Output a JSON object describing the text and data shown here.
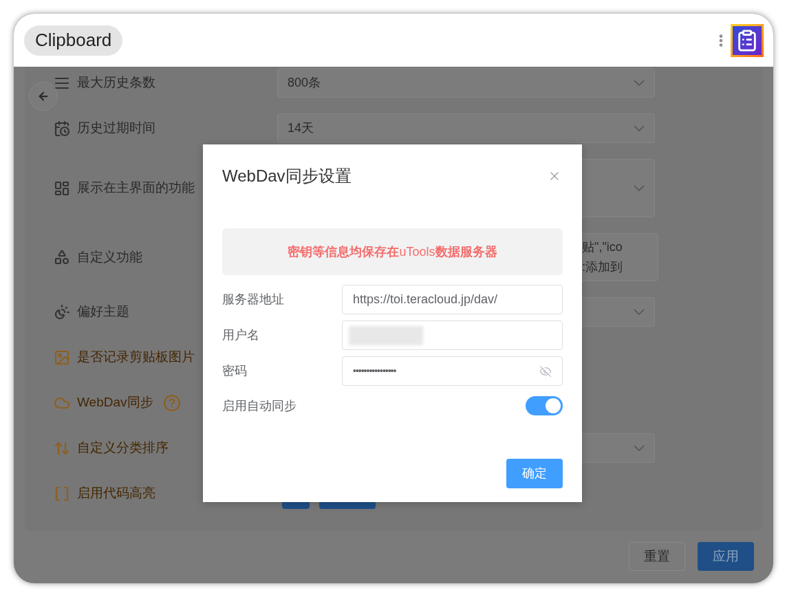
{
  "app": {
    "title": "Clipboard"
  },
  "settings": [
    {
      "label": "最大历史条数",
      "highlighted": false,
      "control": {
        "kind": "select",
        "value": "800条"
      }
    },
    {
      "label": "历史过期时间",
      "highlighted": false,
      "control": {
        "kind": "select",
        "value": "14天"
      }
    },
    {
      "label": "展示在主界面的功能",
      "highlighted": false,
      "control": {
        "kind": "tall_select"
      }
    },
    {
      "label": "自定义功能",
      "highlighted": false,
      "control": {
        "kind": "textarea",
        "lines": [
          "贴\",\"ico",
          ":添加到"
        ]
      }
    },
    {
      "label": "偏好主题",
      "highlighted": false,
      "control": {
        "kind": "select"
      }
    },
    {
      "label": "是否记录剪贴板图片",
      "highlighted": true,
      "control": {
        "kind": "none"
      }
    },
    {
      "label": "WebDav同步",
      "highlighted": true,
      "help": true,
      "control": {
        "kind": "none"
      }
    },
    {
      "label": "自定义分类排序",
      "highlighted": true,
      "control": {
        "kind": "chip_select"
      }
    },
    {
      "label": "启用代码高亮",
      "highlighted": true,
      "control": {
        "kind": "button_pair"
      }
    }
  ],
  "footer": {
    "reset": "重置",
    "apply": "应用"
  },
  "dialog": {
    "title": "WebDav同步设置",
    "notice": "**密钥等信息均保存在**uTools**数据服务器**",
    "fields": [
      {
        "label": "服务器地址",
        "kind": "text",
        "value": "https://toi.teracloud.jp/dav/"
      },
      {
        "label": "用户名",
        "kind": "redacted"
      },
      {
        "label": "密码",
        "kind": "password",
        "value": "••••••••••••••••"
      }
    ],
    "auto_sync": {
      "label": "启用自动同步",
      "on": true
    },
    "confirm": "确定"
  }
}
